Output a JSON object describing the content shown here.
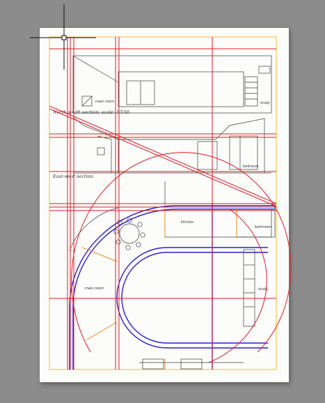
{
  "canvas": {
    "background": "#8c8c8c",
    "sheet_color": "#fcfcfb"
  },
  "colors": {
    "guide_red": "#e01b24",
    "guide_blue": "#2a1fd1",
    "orange": "#f08a1c",
    "page_border": "#f2c12e",
    "ink": "#3a3a3a",
    "crosshair": "#111111"
  },
  "drawing": {
    "labels": {
      "main_room_upper": "main room",
      "study_upper": "study",
      "bedroom": "bedroom",
      "kitchen": "kitchen",
      "bathroom": "bathroom",
      "main_room_plan": "main room",
      "study_plan": "study"
    },
    "captions": {
      "north_south": "North-south section; scale:  1/150.",
      "east_west": "East-west section."
    }
  },
  "cursor": {
    "type": "crosshair",
    "icon": "crosshair-cursor-icon"
  }
}
